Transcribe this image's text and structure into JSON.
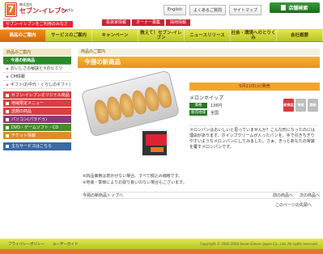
{
  "header": {
    "brand_small": "株式会社",
    "brand": "セブン-イレブン",
    "brand_en": "ジャパン",
    "top_links": [
      "English",
      "よくあるご質問",
      "サイトマップ"
    ],
    "store_search": "店舗検索",
    "home_label": "HOME ›",
    "welcome": "セブン-イレブンをご利用のみなさま",
    "corp_tabs": [
      "投資家情報",
      "オーナー募集",
      "採用情報"
    ]
  },
  "global_nav": [
    "商品のご案内",
    "サービスのご案内",
    "キャンペーン",
    "教えて！セブン-イレブン",
    "ニュースリリース",
    "社会・環境へのとりくみ",
    "会社概要"
  ],
  "sidebar": {
    "head": "商品のご案内",
    "items": [
      "今週の新商品",
      "おいしさの秘訣と⑦のヒミツ",
      "CM情報",
      "ギフト(お中元・くらしのギフト)"
    ],
    "categories": [
      "セブン-イレブンオリジナル商品",
      "地域限定メニュー",
      "話題の商品",
      "パソコン(パラドゥ)",
      "DVD・ゲームソフト・CD",
      "チケット情報"
    ],
    "search": "主なサービスはこちら"
  },
  "main": {
    "breadcrumb": "商品のご案内",
    "title": "今週の新商品",
    "release": "5月11日(火)発売",
    "product_name": "メロンホイップ",
    "price_label": "価格",
    "price": "136円",
    "area_label": "販売地域",
    "area": "全国",
    "badges": [
      "新商品",
      "地域",
      "期間"
    ],
    "description": "メロンパンはおいしいと思っていませんか？こんな形になったのには理由があります。ホイップクリームが入ったパンを、手で引きちぎりやすいようなメロンパンにしてみました。さぁ、きっとあなたの常識を覆すメロンパンです。",
    "notes": [
      "※商品価格は表示がない場合、すべて税込み価格です。",
      "※地域・季節によりお取り扱いのない場合もございます。"
    ],
    "back_link": "今週の新商品トップへ",
    "prev": "前の商品へ",
    "next": "次の商品へ",
    "page_top": "このページの先頭へ"
  },
  "footer": {
    "links": [
      "プライバシーポリシー",
      "ユーザーガイド"
    ],
    "copyright": "Copyright © 2000-2004 Seven-Eleven Japan Co., Ltd. All rights reserved."
  }
}
